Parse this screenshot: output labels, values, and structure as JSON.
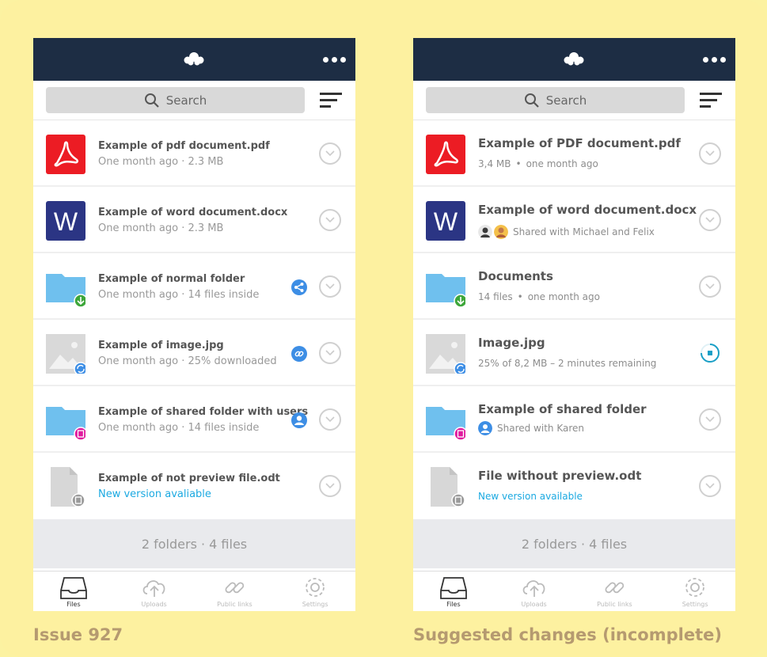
{
  "colors": {
    "background": "#fdf1a0",
    "topbar": "#1d2d44",
    "accent_blue": "#1ba9e1",
    "share_blue": "#3d8ee5",
    "pdf_red": "#ec1c24",
    "word_navy": "#2b3584",
    "folder_blue": "#6fc0ee"
  },
  "phone_a": {
    "search_placeholder": "Search",
    "files": [
      {
        "name": "Example of pdf document.pdf",
        "meta": "One month ago · 2.3 MB",
        "icon": "pdf-icon"
      },
      {
        "name": "Example of word document.docx",
        "meta": "One month ago · 2.3 MB",
        "icon": "word-icon"
      },
      {
        "name": "Example of normal folder",
        "meta": "One month ago · 14 files inside",
        "icon": "folder-download-icon",
        "status": "share-icon"
      },
      {
        "name": "Example of image.jpg",
        "meta": "One month ago · 25% downloaded",
        "icon": "image-sync-icon",
        "status": "link-icon"
      },
      {
        "name": "Example of shared folder with users",
        "meta": "One month ago · 14 files inside",
        "icon": "folder-shared-icon",
        "status": "user-icon"
      },
      {
        "name": "Example of not preview file.odt",
        "meta": "New version avaliable",
        "icon": "generic-file-icon"
      }
    ],
    "summary": "2 folders · 4 files",
    "tabs": [
      "Files",
      "Uploads",
      "Public links",
      "Settings"
    ]
  },
  "phone_b": {
    "search_placeholder": "Search",
    "files": [
      {
        "name": "Example of PDF document.pdf",
        "meta_a": "3,4 MB",
        "meta_b": "one month ago",
        "icon": "pdf-icon"
      },
      {
        "name": "Example of word document.docx",
        "meta": "Shared with Michael and Felix",
        "icon": "word-icon"
      },
      {
        "name": "Documents",
        "meta_a": "14 files",
        "meta_b": "one month ago",
        "icon": "folder-download-icon"
      },
      {
        "name": "Image.jpg",
        "meta": "25% of 8,2 MB – 2 minutes remaining",
        "icon": "image-sync-icon"
      },
      {
        "name": "Example of shared folder",
        "meta": "Shared with Karen",
        "icon": "folder-shared-icon"
      },
      {
        "name": "File without preview.odt",
        "meta": "New version available",
        "icon": "generic-file-icon"
      }
    ],
    "summary": "2 folders · 4 files",
    "tabs": [
      "Files",
      "Uploads",
      "Public links",
      "Settings"
    ]
  },
  "captions": {
    "left": "Issue 927",
    "right": "Suggested changes (incomplete)"
  }
}
